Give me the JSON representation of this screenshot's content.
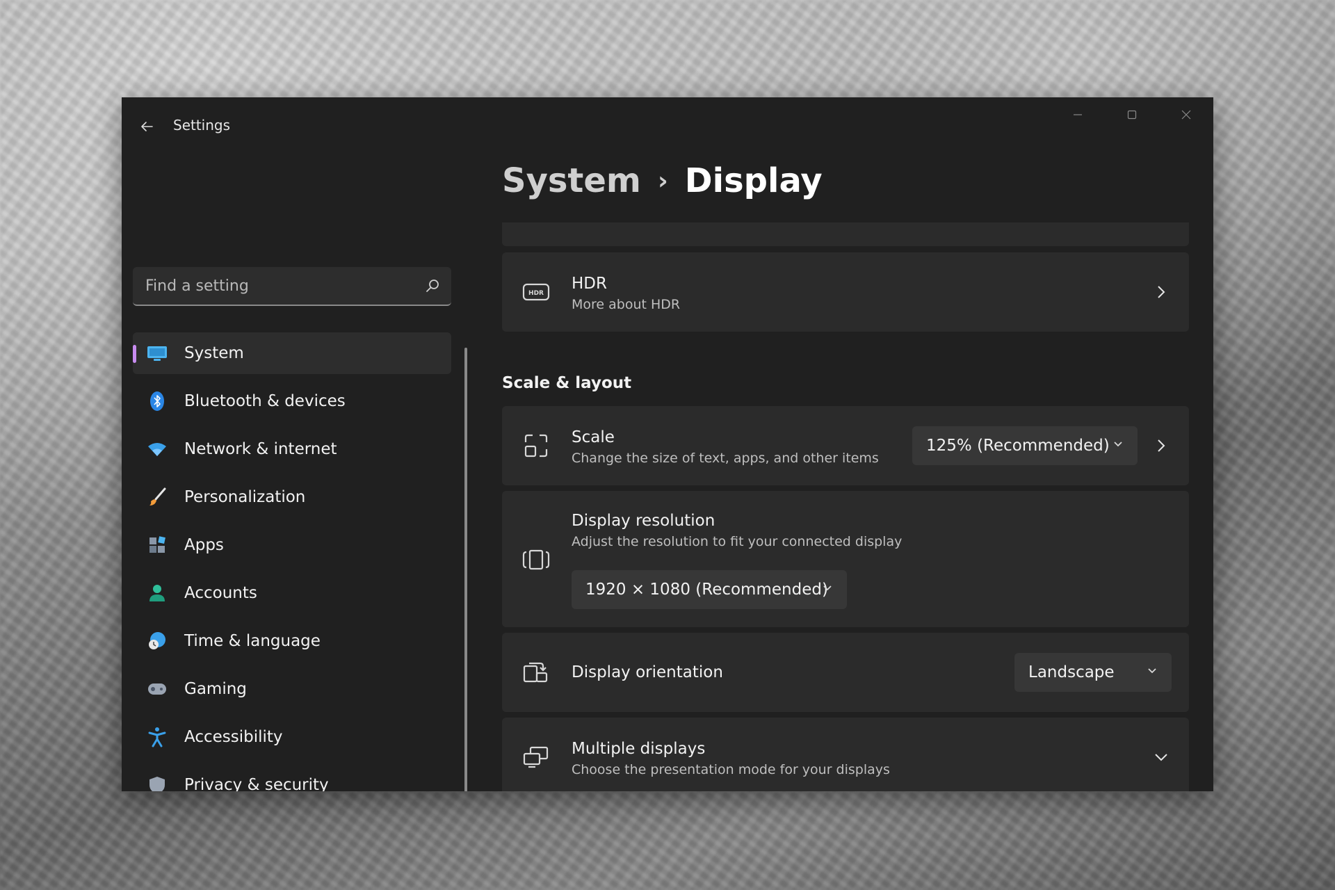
{
  "window": {
    "app_title": "Settings",
    "back_icon": "back-arrow-icon",
    "controls": [
      "minimize",
      "maximize",
      "close"
    ]
  },
  "search": {
    "placeholder": "Find a setting"
  },
  "sidebar": {
    "items": [
      {
        "label": "System",
        "icon": "monitor-icon",
        "active": true
      },
      {
        "label": "Bluetooth & devices",
        "icon": "bluetooth-icon"
      },
      {
        "label": "Network & internet",
        "icon": "wifi-icon"
      },
      {
        "label": "Personalization",
        "icon": "brush-icon"
      },
      {
        "label": "Apps",
        "icon": "apps-icon"
      },
      {
        "label": "Accounts",
        "icon": "person-icon"
      },
      {
        "label": "Time & language",
        "icon": "globe-clock-icon"
      },
      {
        "label": "Gaming",
        "icon": "controller-icon"
      },
      {
        "label": "Accessibility",
        "icon": "accessibility-icon"
      },
      {
        "label": "Privacy & security",
        "icon": "shield-icon"
      }
    ]
  },
  "breadcrumb": {
    "parent": "System",
    "separator": "›",
    "current": "Display"
  },
  "hdr": {
    "title": "HDR",
    "link": "More about HDR"
  },
  "scale_layout": {
    "section_title": "Scale & layout",
    "scale": {
      "title": "Scale",
      "description": "Change the size of text, apps, and other items",
      "value": "125% (Recommended)"
    },
    "resolution": {
      "title": "Display resolution",
      "description": "Adjust the resolution to fit your connected display",
      "value": "1920 × 1080 (Recommended)"
    },
    "orientation": {
      "title": "Display orientation",
      "value": "Landscape"
    },
    "multiple": {
      "title": "Multiple displays",
      "description": "Choose the presentation mode for your displays"
    }
  },
  "colors": {
    "window_bg": "#202020",
    "card_bg": "#2b2b2b",
    "accent": "#c88cf0"
  }
}
